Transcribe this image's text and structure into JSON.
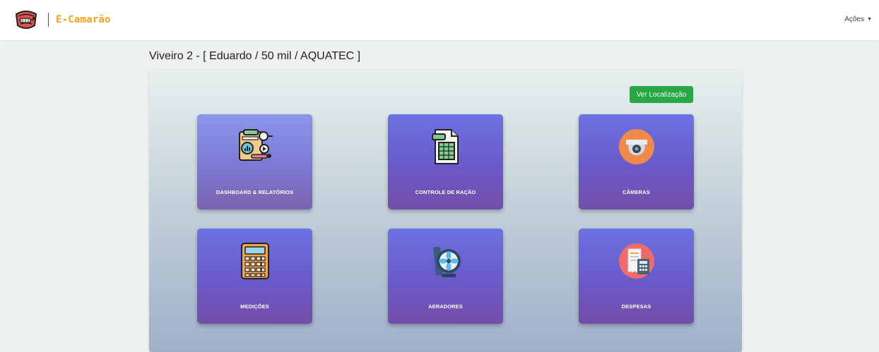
{
  "brand": {
    "name": "E-Camarão",
    "logo_icon": "shrimp-icon"
  },
  "nav": {
    "actions_label": "Ações"
  },
  "page": {
    "title": "Viveiro 2 - [ Eduardo / 50 mil / AQUATEC ]"
  },
  "location_button": {
    "label": "Ver Localização",
    "color": "#28a745"
  },
  "tiles": [
    {
      "label": "DASHBOARD & RELATÓRIOS",
      "icon": "report-analytics-icon"
    },
    {
      "label": "CONTROLE DE RAÇÃO",
      "icon": "spreadsheet-icon"
    },
    {
      "label": "CÂMERAS",
      "icon": "camera-icon"
    },
    {
      "label": "MEDIÇÕES",
      "icon": "calculator-icon"
    },
    {
      "label": "AERADORES",
      "icon": "fan-icon"
    },
    {
      "label": "DESPESAS",
      "icon": "receipt-calculator-icon"
    }
  ],
  "colors": {
    "brand_accent": "#f0a21c",
    "tile_top": "#6c72e3",
    "tile_bottom": "#744ea9"
  }
}
